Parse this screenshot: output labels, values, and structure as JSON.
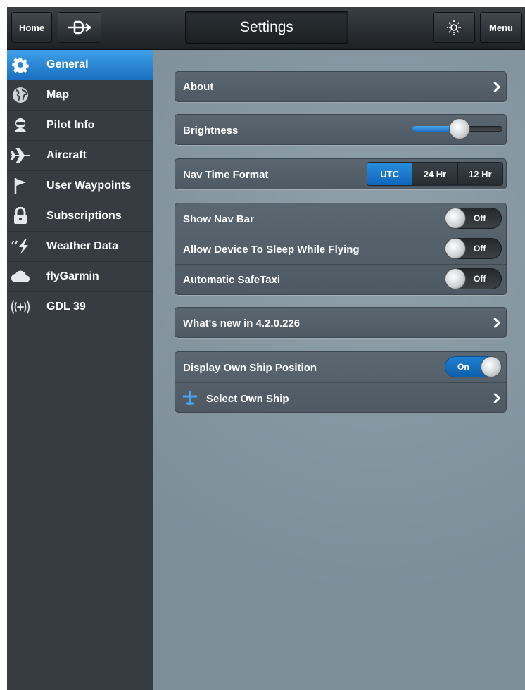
{
  "topbar": {
    "home_label": "Home",
    "title": "Settings",
    "menu_label": "Menu"
  },
  "sidebar": {
    "items": [
      {
        "label": "General",
        "icon": "gear-icon",
        "active": true
      },
      {
        "label": "Map",
        "icon": "globe-icon"
      },
      {
        "label": "Pilot Info",
        "icon": "pilot-icon"
      },
      {
        "label": "Aircraft",
        "icon": "airplane-icon"
      },
      {
        "label": "User Waypoints",
        "icon": "flag-icon"
      },
      {
        "label": "Subscriptions",
        "icon": "lock-icon"
      },
      {
        "label": "Weather Data",
        "icon": "lightning-icon"
      },
      {
        "label": "flyGarmin",
        "icon": "cloud-icon"
      },
      {
        "label": "GDL 39",
        "icon": "signal-icon"
      }
    ]
  },
  "settings": {
    "about": "About",
    "brightness": {
      "label": "Brightness",
      "level": 0.52
    },
    "nav_time": {
      "label": "Nav Time Format",
      "options": [
        "UTC",
        "24 Hr",
        "12 Hr"
      ],
      "selected": "UTC"
    },
    "toggles": [
      {
        "label": "Show Nav Bar",
        "state": "Off"
      },
      {
        "label": "Allow Device To Sleep While Flying",
        "state": "Off"
      },
      {
        "label": "Automatic SafeTaxi",
        "state": "Off"
      }
    ],
    "whats_new": "What's new in 4.2.0.226",
    "own_ship": {
      "label": "Display Own Ship Position",
      "state": "On"
    },
    "select_own_ship": "Select Own Ship"
  },
  "colors": {
    "accent": "#1a7ad0",
    "sidebar_bg": "#363c41",
    "main_bg": "#8495a0"
  }
}
